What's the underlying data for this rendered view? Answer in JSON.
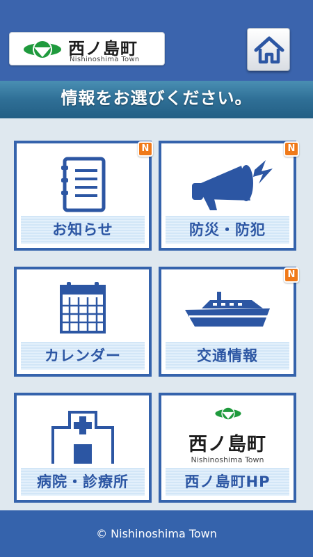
{
  "header": {
    "logo_name": "西ノ島町",
    "logo_sub": "Nishinoshima Town",
    "home_icon": "home-icon",
    "bg_color": "#3b64ad"
  },
  "banner": {
    "text": "情報をお選びください。"
  },
  "tiles": [
    {
      "label": "お知らせ",
      "icon": "notebook-icon",
      "badge": "N"
    },
    {
      "label": "防災・防犯",
      "icon": "megaphone-icon",
      "badge": "N"
    },
    {
      "label": "カレンダー",
      "icon": "calendar-icon",
      "badge": ""
    },
    {
      "label": "交通情報",
      "icon": "ship-icon",
      "badge": "N"
    },
    {
      "label": "病院・診療所",
      "icon": "hospital-icon",
      "badge": ""
    },
    {
      "label": "西ノ島町HP",
      "icon": "town-logo-icon",
      "badge": "",
      "logo_name": "西ノ島町",
      "logo_sub": "Nishinoshima Town"
    }
  ],
  "footer": {
    "copyright": "© Nishinoshima Town"
  },
  "colors": {
    "accent": "#3563ac",
    "badge": "#f07a1a",
    "logo_green": "#1f9a3d"
  }
}
